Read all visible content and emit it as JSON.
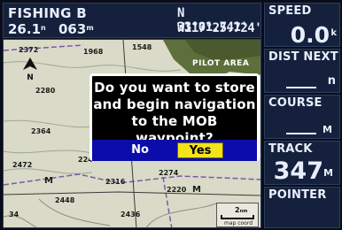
{
  "status": {
    "waypoint_name": "FISHING B",
    "distance": "26.1",
    "distance_unit": "n",
    "bearing": "063",
    "bearing_unit": "m",
    "lat": "N  33°01.741'",
    "lon": "W117°25.724'"
  },
  "map": {
    "labels": [
      "2372",
      "1968",
      "1548",
      "2280",
      "2364",
      "2472",
      "224",
      "2316",
      "2274",
      "2220",
      "2448",
      "2436",
      "34",
      "M",
      "M"
    ],
    "area_label": "PILOT AREA",
    "scale": {
      "value": "2",
      "unit": "nm",
      "mode": "map coord"
    },
    "north_icon": "north-arrow-icon"
  },
  "dialog": {
    "message_lines": [
      "Do you want to store",
      "and begin navigation",
      "to the MOB waypoint?"
    ],
    "no_label": "No",
    "yes_label": "Yes",
    "selected": "Yes"
  },
  "fields": {
    "speed": {
      "label": "SPEED",
      "value": "0.0",
      "unit": "k"
    },
    "dist_next": {
      "label": "DIST NEXT",
      "unit": "n"
    },
    "course": {
      "label": "COURSE",
      "unit": "M"
    },
    "track": {
      "label": "TRACK",
      "value": "347",
      "unit": "M"
    },
    "pointer": {
      "label": "POINTER"
    }
  },
  "colors": {
    "panel": "#15213c",
    "map_land": "#d9dac7",
    "dialog_bar": "#0c0caa",
    "highlight": "#f2e418"
  }
}
